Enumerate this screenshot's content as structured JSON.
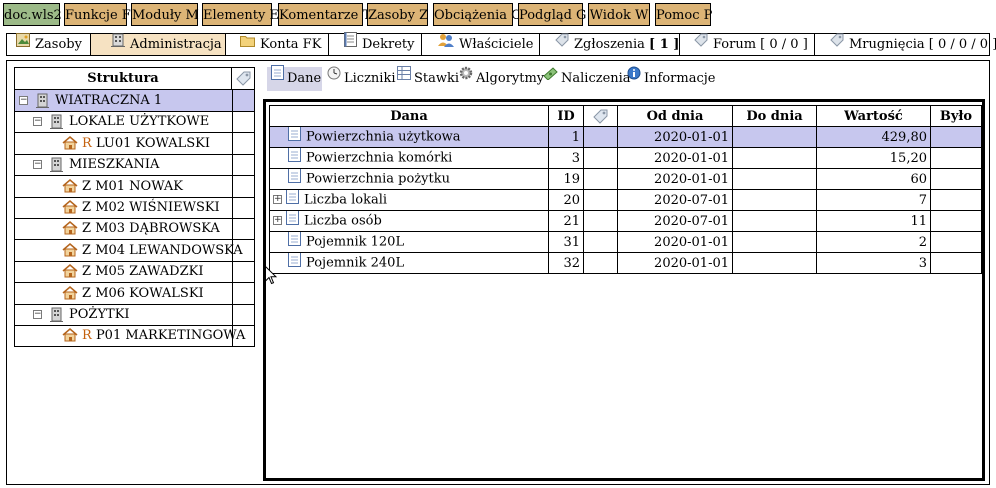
{
  "top_menu": [
    {
      "label": "doc.wls2",
      "active": true
    },
    {
      "label": "Funkcje F"
    },
    {
      "label": "Moduły M"
    },
    {
      "label": "Elementy E"
    },
    {
      "label": "Komentarze T"
    },
    {
      "label": "Zasoby Z"
    },
    {
      "label": "Obciążenia O"
    },
    {
      "label": "Podgląd G"
    },
    {
      "label": "Widok W"
    },
    {
      "label": "Pomoc P"
    }
  ],
  "tabs": [
    {
      "label": "Zasoby",
      "icon": "image-icon"
    },
    {
      "label": "Administracja",
      "icon": "building-icon",
      "active": true
    },
    {
      "label": "Konta FK",
      "icon": "folder-icon"
    },
    {
      "label": "Dekrety",
      "icon": "document-icon"
    },
    {
      "label": "Właściciele",
      "icon": "users-icon"
    },
    {
      "label": "Zgłoszenia",
      "badge": "[ 1 ]",
      "icon": "tag-icon"
    },
    {
      "label": "Forum [ 0 / 0 ]",
      "icon": "tag-icon"
    },
    {
      "label": "Mrugnięcia [ 0 / 0 / 0 ]",
      "icon": "tag-icon"
    }
  ],
  "tree": {
    "header": "Struktura",
    "nodes": [
      {
        "label": "WIATRACZNA 1",
        "level": 0,
        "expander": "−",
        "icon": "building",
        "selected": true
      },
      {
        "label": "LOKALE UŻYTKOWE",
        "level": 1,
        "expander": "−",
        "icon": "building"
      },
      {
        "prefix": "R",
        "label": "LU01 KOWALSKI",
        "level": 2,
        "icon": "house"
      },
      {
        "label": "MIESZKANIA",
        "level": 1,
        "expander": "−",
        "icon": "building"
      },
      {
        "prefix": "Z",
        "label": "M01 NOWAK",
        "level": 2,
        "icon": "house"
      },
      {
        "prefix": "Z",
        "label": "M02 WIŚNIEWSKI",
        "level": 2,
        "icon": "house"
      },
      {
        "prefix": "Z",
        "label": "M03 DĄBROWSKA",
        "level": 2,
        "icon": "house"
      },
      {
        "prefix": "Z",
        "label": "M04 LEWANDOWSKA",
        "level": 2,
        "icon": "house"
      },
      {
        "prefix": "Z",
        "label": "M05 ZAWADZKI",
        "level": 2,
        "icon": "house"
      },
      {
        "prefix": "Z",
        "label": "M06 KOWALSKI",
        "level": 2,
        "icon": "house"
      },
      {
        "label": "POŻYTKI",
        "level": 1,
        "expander": "−",
        "icon": "building"
      },
      {
        "prefix": "R",
        "label": "P01 MARKETINGOWA",
        "level": 2,
        "icon": "house"
      }
    ]
  },
  "subtabs": [
    {
      "label": "Dane",
      "icon": "document-icon",
      "active": true
    },
    {
      "label": "Liczniki",
      "icon": "clock-icon"
    },
    {
      "label": "Stawki",
      "icon": "table-icon"
    },
    {
      "label": "Algorytmy",
      "icon": "gear-icon"
    },
    {
      "label": "Naliczenia",
      "icon": "money-icon"
    },
    {
      "label": "Informacje",
      "icon": "info-icon"
    }
  ],
  "table": {
    "columns": [
      "Dana",
      "ID",
      "",
      "Od dnia",
      "Do dnia",
      "Wartość",
      "Było"
    ],
    "rows": [
      {
        "name": "Powierzchnia użytkowa",
        "id": "1",
        "from": "2020-01-01",
        "to": "",
        "value": "429,80",
        "was": "",
        "selected": true
      },
      {
        "name": "Powierzchnia komórki",
        "id": "3",
        "from": "2020-01-01",
        "to": "",
        "value": "15,20",
        "was": ""
      },
      {
        "name": "Powierzchnia pożytku",
        "id": "19",
        "from": "2020-01-01",
        "to": "",
        "value": "60",
        "was": ""
      },
      {
        "name": "Liczba lokali",
        "id": "20",
        "from": "2020-07-01",
        "to": "",
        "value": "7",
        "was": "",
        "expandable": true
      },
      {
        "name": "Liczba osób",
        "id": "21",
        "from": "2020-07-01",
        "to": "",
        "value": "11",
        "was": "",
        "expandable": true
      },
      {
        "name": "Pojemnik 120L",
        "id": "31",
        "from": "2020-01-01",
        "to": "",
        "value": "2",
        "was": ""
      },
      {
        "name": "Pojemnik 240L",
        "id": "32",
        "from": "2020-01-01",
        "to": "",
        "value": "3",
        "was": ""
      }
    ]
  }
}
